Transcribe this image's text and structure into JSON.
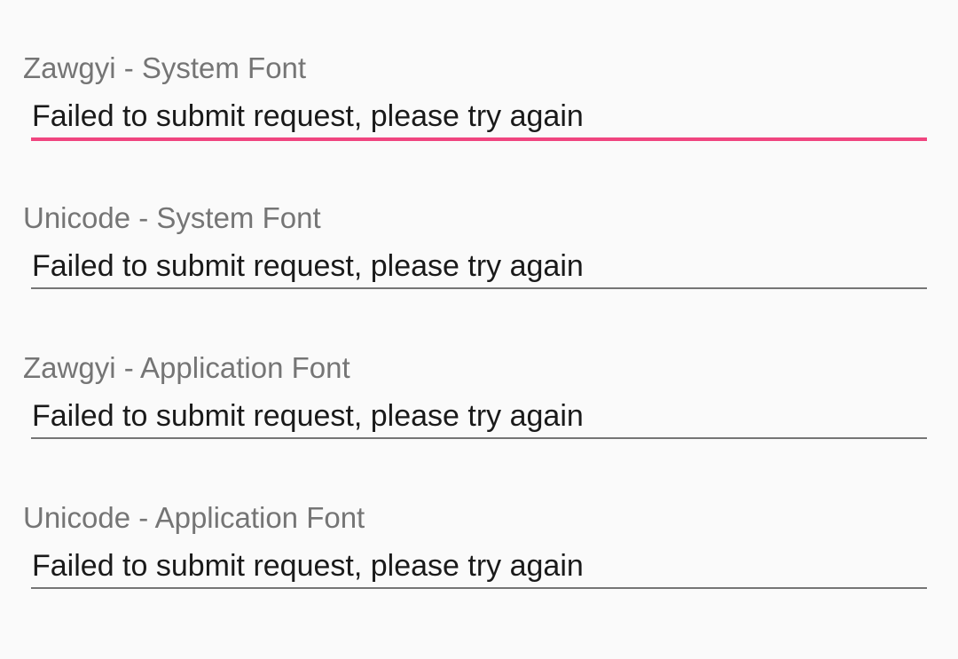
{
  "accent_color": "#f0457f",
  "fields": [
    {
      "label": "Zawgyi - System Font",
      "value": "Failed to submit request, please try again",
      "focused": true
    },
    {
      "label": "Unicode - System Font",
      "value": "Failed to submit request, please try again",
      "focused": false
    },
    {
      "label": "Zawgyi - Application Font",
      "value": "Failed to submit request, please try again",
      "focused": false
    },
    {
      "label": "Unicode - Application Font",
      "value": "Failed to submit request, please try again",
      "focused": false
    }
  ]
}
